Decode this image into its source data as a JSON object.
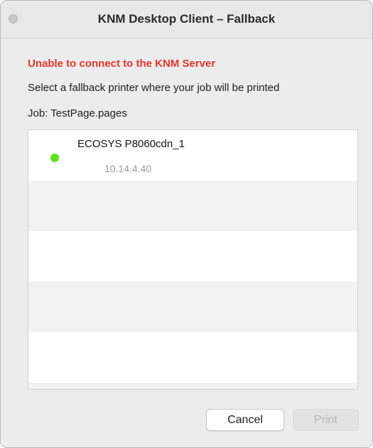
{
  "window": {
    "title": "KNM Desktop Client – Fallback"
  },
  "message": {
    "error": "Unable to connect to the KNM Server",
    "instruction": "Select a fallback printer where your job will be printed",
    "job": "Job: TestPage.pages"
  },
  "printers": [
    {
      "name": "ECOSYS P8060cdn_1",
      "ip": "10.14.4.40",
      "status_color": "#5fe11a"
    }
  ],
  "buttons": {
    "cancel": "Cancel",
    "print": "Print"
  },
  "colors": {
    "error": "#e8352b",
    "row_alt": "#f1f3f3",
    "status_online": "#5fe11a"
  }
}
